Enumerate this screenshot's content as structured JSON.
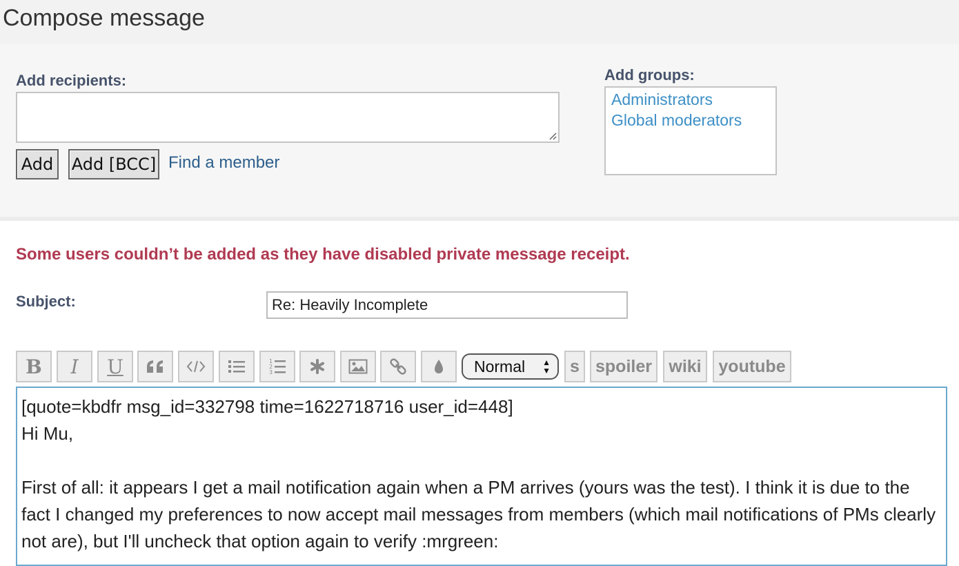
{
  "header": {
    "title": "Compose message"
  },
  "recipients": {
    "label": "Add recipients:",
    "value": "",
    "add_label": "Add",
    "add_bcc_label": "Add [BCC]",
    "find_member_label": "Find a member"
  },
  "groups": {
    "label": "Add groups:",
    "items": [
      "Administrators",
      "Global moderators"
    ]
  },
  "warning": {
    "text": "Some users couldn’t be added as they have disabled private message receipt."
  },
  "subject": {
    "label": "Subject:",
    "value": "Re: Heavily Incomplete"
  },
  "toolbar": {
    "bold_label": "B",
    "italic_label": "I",
    "underline_label": "U",
    "font_size_value": "Normal",
    "strike_label": "s",
    "spoiler_label": "spoiler",
    "wiki_label": "wiki",
    "youtube_label": "youtube",
    "icons": [
      "bold-icon",
      "italic-icon",
      "underline-icon",
      "quote-icon",
      "code-icon",
      "bullet-list-icon",
      "numbered-list-icon",
      "list-item-icon",
      "image-icon",
      "link-icon",
      "color-icon"
    ]
  },
  "editor": {
    "text": "[quote=kbdfr msg_id=332798 time=1622718716 user_id=448]\nHi Mu,\n\nFirst of all: it appears I get a mail notification again when a PM arrives (yours was the test). I think it is due to the fact I changed my preferences to now accept mail messages from members (which mail notifications of PMs clearly not are), but I'll uncheck that option again to verify :mrgreen:"
  },
  "colors": {
    "link": "#2d5f8b",
    "group_link": "#3d8fc6",
    "warning": "#b03a52",
    "label": "#47536b",
    "editor_border": "#6aa9cf"
  }
}
